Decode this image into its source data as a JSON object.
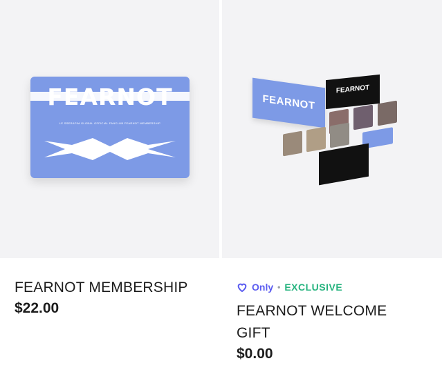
{
  "products": [
    {
      "title": "FEARNOT MEMBERSHIP",
      "price": "$22.00",
      "art": {
        "logo_text": "FEARNOT",
        "card_sub": "LE SSERAFIM GLOBAL OFFICIAL FANCLUB FEARNOT MEMBERSHIP",
        "card_color": "#7d9ae6"
      }
    },
    {
      "badge_only": "Only",
      "badge_exclusive": "EXCLUSIVE",
      "title_line1": "FEARNOT WELCOME",
      "title_line2": "GIFT",
      "price": "$0.00",
      "art": {
        "box_logo": "FEARNOT",
        "black_logo": "FEARNOT"
      }
    }
  ],
  "colors": {
    "only": "#5b5cf0",
    "exclusive": "#25b37e",
    "thumb_bg": "#f3f3f5"
  }
}
